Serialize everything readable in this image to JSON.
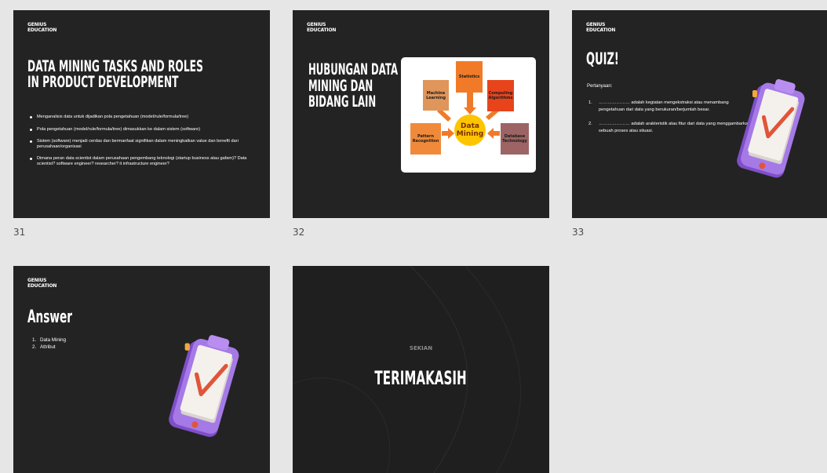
{
  "slides": [
    {
      "number": "31",
      "brand": [
        "GENIUS",
        "EDUCATION"
      ],
      "title": [
        "DATA MINING TASKS AND ROLES",
        "IN PRODUCT DEVELOPMENT"
      ],
      "bullets": [
        "Menganalisis data untuk dijadikan pola pengetahuan (model/rule/formula/tree)",
        "Pola pengetahuan (model/rule/formula/tree) dimasukkan ke dalam sistem (software)",
        "Sistem (software) menjadi cerdas dan bermanfaat signifikan dalam meningkatkan value dan benefit dari perusahaan/organisasi",
        "Dimana peran data scientist dalam perusahaan pengembang teknologi (startup business atau gafam)? Data scientist? software engineer? researcher? it infrastructure engineer?"
      ]
    },
    {
      "number": "32",
      "brand": [
        "GENIUS",
        "EDUCATION"
      ],
      "title": [
        "HUBUNGAN DATA",
        "MINING DAN",
        "BIDANG LAIN"
      ],
      "diagram": {
        "center": [
          "Data",
          "Mining"
        ],
        "nodes": [
          {
            "label": [
              "Machine",
              "Learning"
            ],
            "color": "#e0955a"
          },
          {
            "label": [
              "Statistics"
            ],
            "color": "#f07a28"
          },
          {
            "label": [
              "Computing",
              "Algorithms"
            ],
            "color": "#e8441c"
          },
          {
            "label": [
              "Pattern",
              "Recognition"
            ],
            "color": "#f08a3a"
          },
          {
            "label": [
              "Database",
              "Technology"
            ],
            "color": "#9c6464"
          }
        ]
      }
    },
    {
      "number": "33",
      "brand": [
        "GENIUS",
        "EDUCATION"
      ],
      "title": "QUIZ!",
      "subtitle": "Pertanyaan:",
      "questions": [
        {
          "n": "1.",
          "text": "………………… adalah kegiatan mengekstraksi atau menambang pengetahuan dari data yang berukuran/berjumlah besar."
        },
        {
          "n": "2.",
          "text": "………………… adalah arakteristik atau fitur dari data yang menggambarkan sebuah proses atau situasi."
        }
      ]
    },
    {
      "number": "",
      "brand": [
        "GENIUS",
        "EDUCATION"
      ],
      "title": "Answer",
      "answers": [
        {
          "n": "1.",
          "text": "Data Mining"
        },
        {
          "n": "2.",
          "text": "Attribut"
        }
      ]
    },
    {
      "number": "",
      "subtitle": "SEKIAN",
      "title": "TERIMAKASIH"
    }
  ],
  "colors": {
    "background": "#e6e6e6",
    "slide": "#232323",
    "clipboard": "#9b6ee0",
    "check": "#e0553a",
    "center": "#fdc500"
  },
  "icons": [
    "clipboard-check-icon",
    "clipboard-check-icon"
  ]
}
